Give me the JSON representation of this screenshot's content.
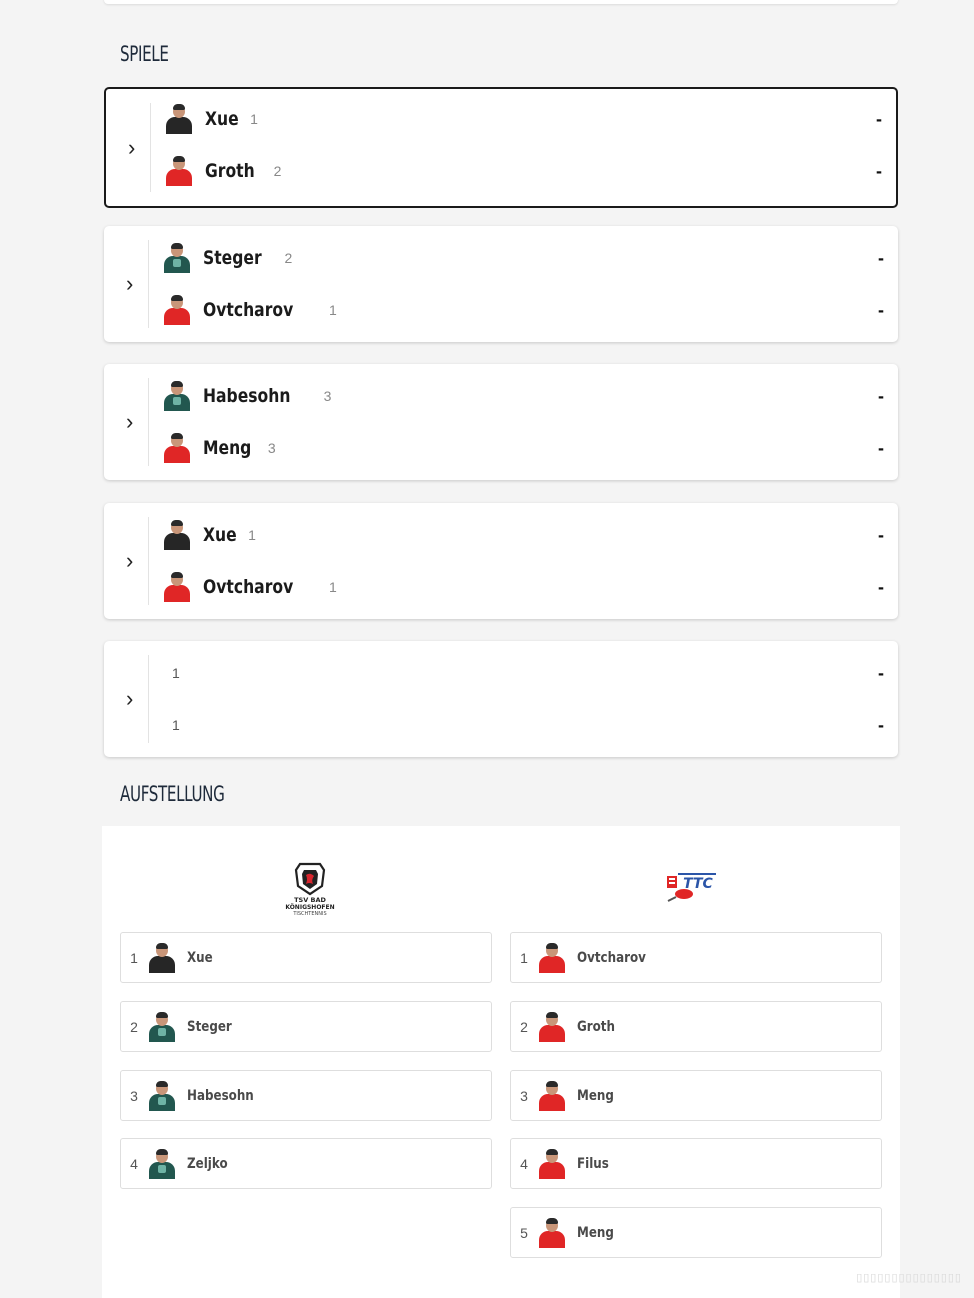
{
  "sections": {
    "games_title": "SPIELE",
    "lineup_title": "AUFSTELLUNG"
  },
  "games": [
    {
      "home": {
        "name": "Xue",
        "rank": "1",
        "avatar": "black"
      },
      "away": {
        "name": "Groth",
        "rank": "2",
        "avatar": "red"
      },
      "home_score": "-",
      "away_score": "-",
      "active": true
    },
    {
      "home": {
        "name": "Steger",
        "rank": "2",
        "avatar": "teal"
      },
      "away": {
        "name": "Ovtcharov",
        "rank": "1",
        "avatar": "red"
      },
      "home_score": "-",
      "away_score": "-"
    },
    {
      "home": {
        "name": "Habesohn",
        "rank": "3",
        "avatar": "teal"
      },
      "away": {
        "name": "Meng",
        "rank": "3",
        "avatar": "red"
      },
      "home_score": "-",
      "away_score": "-"
    },
    {
      "home": {
        "name": "Xue",
        "rank": "1",
        "avatar": "black"
      },
      "away": {
        "name": "Ovtcharov",
        "rank": "1",
        "avatar": "red"
      },
      "home_score": "-",
      "away_score": "-"
    },
    {
      "home": {
        "name": "",
        "rank": "1"
      },
      "away": {
        "name": "",
        "rank": "1"
      },
      "home_score": "-",
      "away_score": "-"
    }
  ],
  "lineup": {
    "home_logo_text": [
      "TSV BAD",
      "KÖNIGSHOFEN",
      "TISCHTENNIS"
    ],
    "away_logo_text": "TTC",
    "home": [
      {
        "num": "1",
        "name": "Xue",
        "avatar": "black"
      },
      {
        "num": "2",
        "name": "Steger",
        "avatar": "teal"
      },
      {
        "num": "3",
        "name": "Habesohn",
        "avatar": "teal"
      },
      {
        "num": "4",
        "name": "Zeljko",
        "avatar": "teal"
      }
    ],
    "away": [
      {
        "num": "1",
        "name": "Ovtcharov",
        "avatar": "red"
      },
      {
        "num": "2",
        "name": "Groth",
        "avatar": "red"
      },
      {
        "num": "3",
        "name": "Meng",
        "avatar": "red"
      },
      {
        "num": "4",
        "name": "Filus",
        "avatar": "red"
      },
      {
        "num": "5",
        "name": "Meng",
        "avatar": "red"
      }
    ]
  },
  "colors": {
    "accent_dark": "#1e2a3a",
    "home_red": "#e02626",
    "teal_jersey": "#22574f"
  }
}
